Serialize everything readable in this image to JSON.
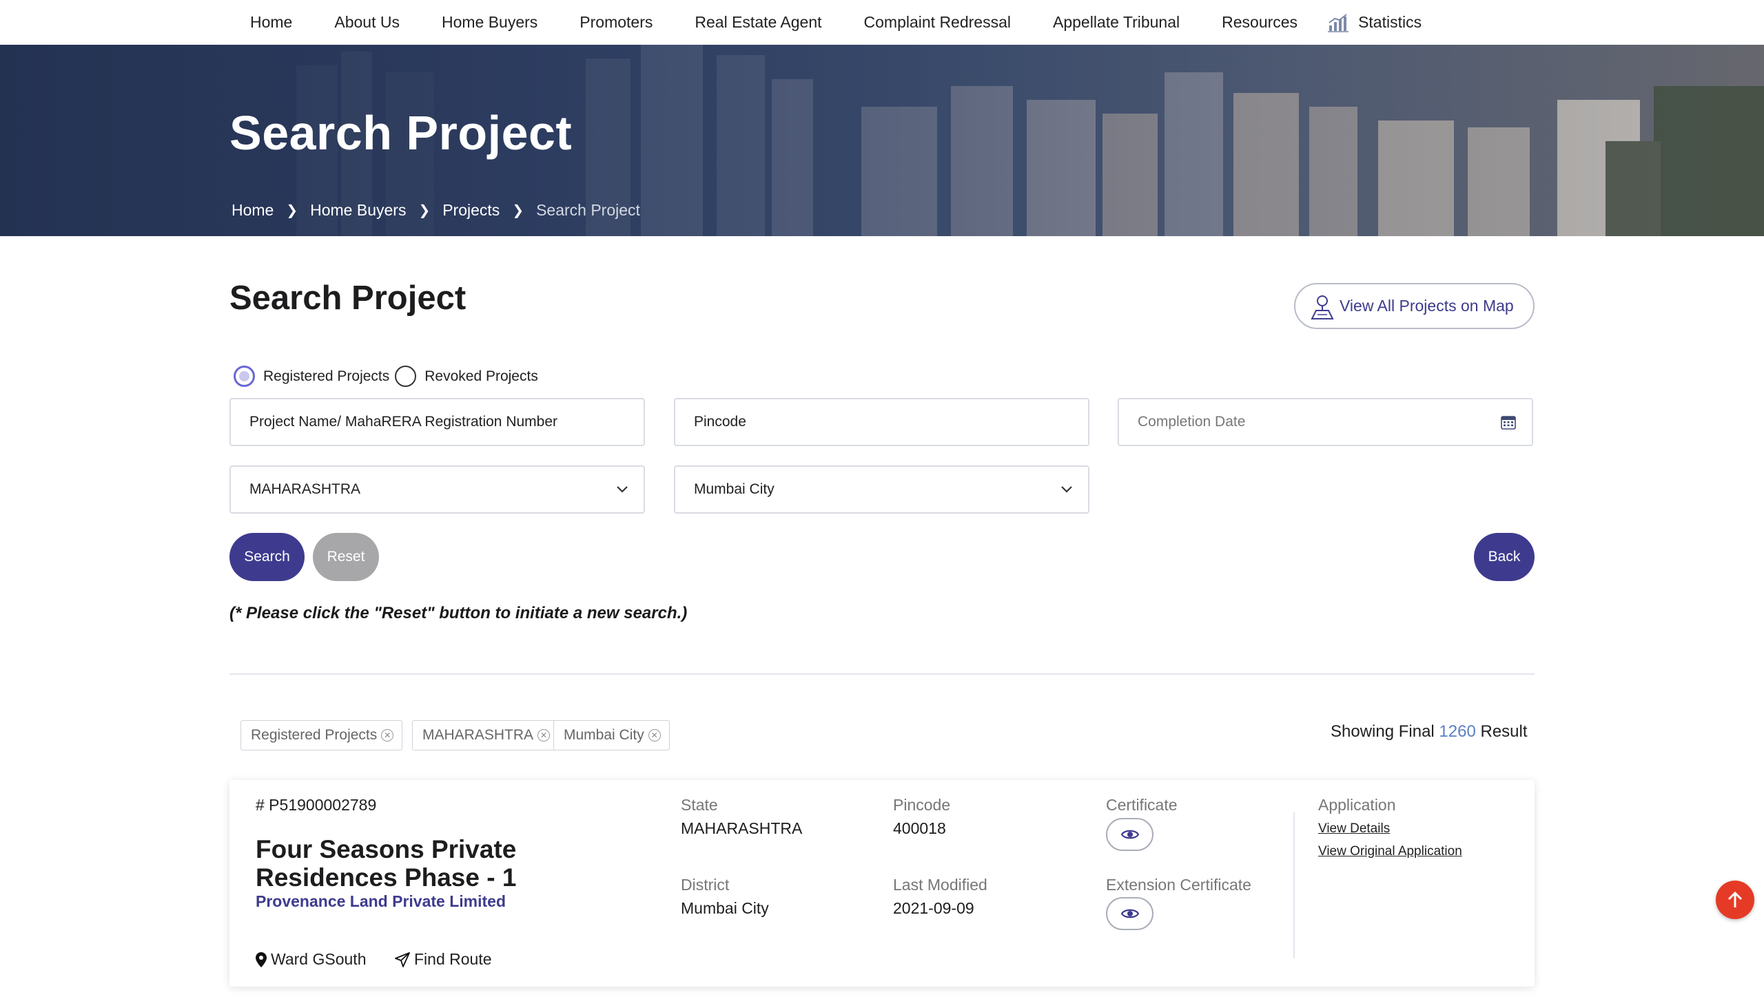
{
  "nav": {
    "items": [
      "Home",
      "About Us",
      "Home Buyers",
      "Promoters",
      "Real Estate Agent",
      "Complaint Redressal",
      "Appellate Tribunal",
      "Resources"
    ],
    "statistics_label": "Statistics"
  },
  "hero": {
    "title": "Search Project",
    "breadcrumb": [
      "Home",
      "Home Buyers",
      "Projects",
      "Search Project"
    ]
  },
  "search": {
    "heading": "Search Project",
    "map_button": "View All Projects on Map",
    "radio_registered": "Registered Projects",
    "radio_revoked": "Revoked Projects",
    "project_name": "Project Name/ MahaRERA Registration Number",
    "pincode": "Pincode",
    "completion_date_placeholder": "Completion Date",
    "state": "MAHARASHTRA",
    "district": "Mumbai City",
    "search_btn": "Search",
    "reset_btn": "Reset",
    "back_btn": "Back",
    "note": "(* Please click the \"Reset\" button to initiate a new search.)"
  },
  "filters": {
    "chips": [
      "Registered Projects",
      "MAHARASHTRA",
      "Mumbai City"
    ],
    "showing_prefix": "Showing Final",
    "count": "1260",
    "showing_suffix": "Result"
  },
  "project": {
    "reg_no": "# P51900002789",
    "name": "Four Seasons Private Residences Phase - 1",
    "promoter": "Provenance Land Private Limited",
    "ward": "Ward GSouth",
    "find_route": "Find Route",
    "state_label": "State",
    "state": "MAHARASHTRA",
    "district_label": "District",
    "district": "Mumbai City",
    "pincode_label": "Pincode",
    "pincode": "400018",
    "modified_label": "Last Modified",
    "modified": "2021-09-09",
    "certificate_label": "Certificate",
    "ext_certificate_label": "Extension Certificate",
    "application_label": "Application",
    "view_details": "View Details",
    "view_original": "View Original Application"
  },
  "colors": {
    "primary": "#3e3b8f",
    "accent_count": "#5b7fc7",
    "scroll_top": "#e53b26"
  },
  "icons": [
    "statistics-icon",
    "chevron-right-icon",
    "map-person-icon",
    "calendar-icon",
    "chevron-down-icon",
    "close-circle-icon",
    "map-pin-icon",
    "send-icon",
    "eye-icon",
    "arrow-up-icon"
  ]
}
